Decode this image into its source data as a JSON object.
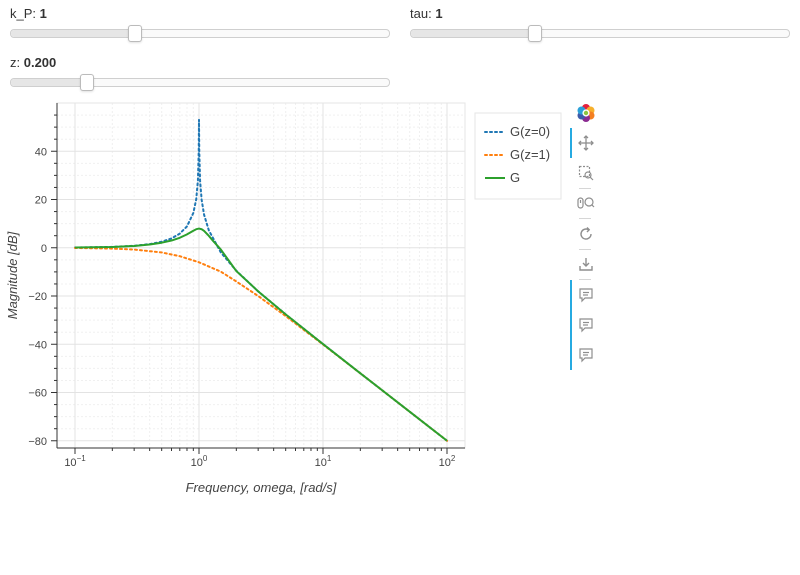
{
  "sliders": [
    {
      "id": "kp",
      "name": "k_P",
      "value": "1",
      "fraction": 0.327
    },
    {
      "id": "tau",
      "name": "tau",
      "value": "1",
      "fraction": 0.327
    },
    {
      "id": "z",
      "name": "z",
      "value": "0.200",
      "fraction": 0.202
    }
  ],
  "toolbar": {
    "logo_icon": "bokeh-logo-icon",
    "tools": [
      "pan-icon",
      "box-zoom-icon",
      "wheel-zoom-icon",
      "reset-icon",
      "save-icon",
      "hover-icon",
      "hover-icon",
      "hover-icon"
    ],
    "accent_color": "#26aae1"
  },
  "chart_data": {
    "type": "line",
    "xlabel": "Frequency, omega, [rad/s]",
    "ylabel": "Magnitude [dB]",
    "x_scale": "log",
    "xlim": [
      0.1,
      100
    ],
    "ylim": [
      -83,
      60
    ],
    "x_ticks": [
      0.1,
      1,
      10,
      100
    ],
    "x_tick_labels": [
      {
        "base": "10",
        "exp": "−1"
      },
      {
        "base": "10",
        "exp": "0"
      },
      {
        "base": "10",
        "exp": "1"
      },
      {
        "base": "10",
        "exp": "2"
      }
    ],
    "y_ticks": [
      -80,
      -60,
      -40,
      -20,
      0,
      20,
      40
    ],
    "y_tick_labels": [
      "−80",
      "−60",
      "−40",
      "−20",
      "0",
      "20",
      "40"
    ],
    "grid": true,
    "legend_position": "right",
    "series": [
      {
        "name": "G(z=0)",
        "color": "#1f77b4",
        "dash": "dotted",
        "x": [
          0.1,
          0.2,
          0.3,
          0.4,
          0.5,
          0.6,
          0.7,
          0.8,
          0.9,
          0.95,
          0.98,
          0.995,
          1.0,
          1.005,
          1.02,
          1.05,
          1.1,
          1.2,
          1.5,
          2,
          3,
          5,
          10,
          20,
          50,
          100
        ],
        "y": [
          0.09,
          0.35,
          0.82,
          1.51,
          2.5,
          3.88,
          5.85,
          8.87,
          14.42,
          20.1,
          28.0,
          40.0,
          53,
          40.0,
          27.9,
          19.9,
          13.6,
          7.22,
          -1.94,
          -9.54,
          -18.06,
          -27.6,
          -39.91,
          -52.03,
          -67.96,
          -79.99
        ]
      },
      {
        "name": "G(z=1)",
        "color": "#ff7f0e",
        "dash": "dotted",
        "x": [
          0.1,
          0.2,
          0.3,
          0.5,
          0.7,
          1,
          1.5,
          2,
          3,
          5,
          10,
          20,
          50,
          100
        ],
        "y": [
          -0.09,
          -0.34,
          -0.75,
          -1.94,
          -3.5,
          -6.02,
          -9.9,
          -13.98,
          -20.0,
          -28.3,
          -40.09,
          -52.04,
          -67.96,
          -80.0
        ]
      },
      {
        "name": "G",
        "color": "#2ca02c",
        "dash": "solid",
        "x": [
          0.1,
          0.2,
          0.3,
          0.4,
          0.5,
          0.6,
          0.7,
          0.8,
          0.9,
          0.95,
          1.0,
          1.05,
          1.1,
          1.2,
          1.3,
          1.5,
          2,
          3,
          5,
          10,
          20,
          50,
          100
        ],
        "y": [
          0.08,
          0.32,
          0.74,
          1.33,
          2.09,
          3.0,
          4.14,
          5.54,
          7.06,
          7.69,
          7.96,
          7.68,
          6.97,
          4.94,
          2.82,
          -0.76,
          -9.66,
          -18.06,
          -27.62,
          -39.92,
          -52.03,
          -67.96,
          -79.99
        ]
      }
    ]
  }
}
